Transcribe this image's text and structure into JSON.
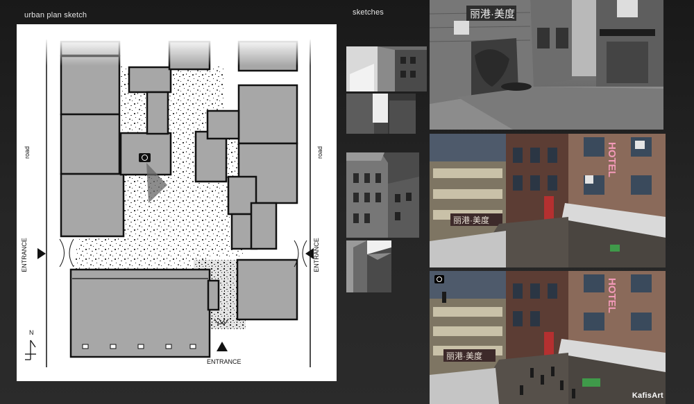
{
  "labels": {
    "plan_title": "urban plan sketch",
    "sketches_title": "sketches"
  },
  "plan": {
    "road_left": "road",
    "road_right": "road",
    "entrance_left": "ENTRANCE",
    "entrance_right": "ENTRANCE",
    "entrance_bottom": "ENTRANCE",
    "north": "N",
    "camera_icon": "camera-icon"
  },
  "renders": {
    "shop_sign": "丽港·美度",
    "hotel_sign": "HOTEL",
    "watermark": "KafisArt"
  },
  "colors": {
    "page_bg": "#222222",
    "building_fill": "#a7a7a7",
    "plan_bg": "#ffffff",
    "hotel_neon": "#f29ab8"
  }
}
